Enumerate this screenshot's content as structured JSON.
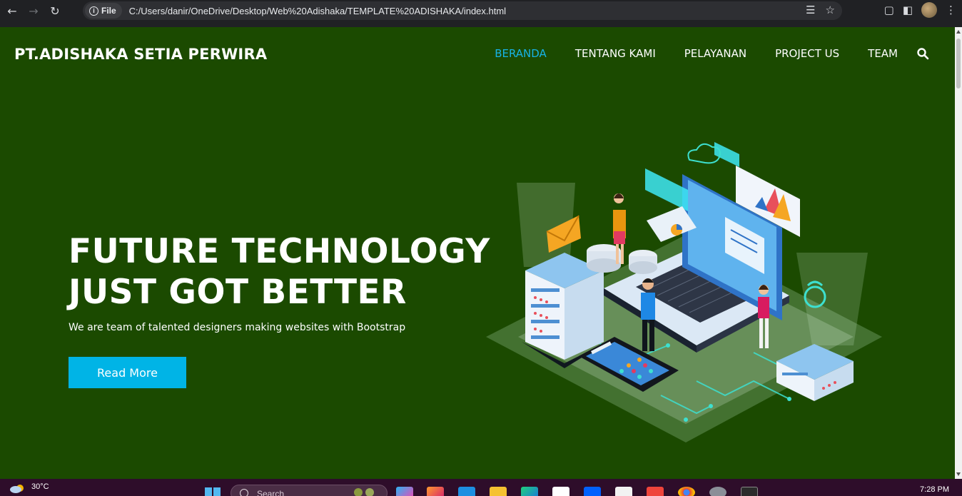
{
  "browser": {
    "file_chip_label": "File",
    "url": "C:/Users/danir/OneDrive/Desktop/Web%20Adishaka/TEMPLATE%20ADISHAKA/index.html",
    "icons": [
      "back-icon",
      "forward-icon",
      "reload-icon",
      "info-icon",
      "translate-icon",
      "bookmark-star-icon",
      "extensions-icon",
      "sidebar-icon",
      "profile-avatar",
      "menu-kebab-icon"
    ]
  },
  "site": {
    "brand": "PT.ADISHAKA SETIA PERWIRA",
    "menu": [
      {
        "label": "BERANDA",
        "active": true
      },
      {
        "label": "TENTANG KAMI",
        "active": false
      },
      {
        "label": "PELAYANAN",
        "active": false
      },
      {
        "label": "PROJECT US",
        "active": false
      },
      {
        "label": "TEAM",
        "active": false
      }
    ],
    "search_icon": "search-icon"
  },
  "hero": {
    "title_line1": "FUTURE TECHNOLOGY",
    "title_line2": "JUST GOT BETTER",
    "subtitle": "We are team of talented designers making websites with Bootstrap",
    "cta_label": "Read More"
  },
  "colors": {
    "page_bg": "#1b4a00",
    "accent": "#17b3e6",
    "button": "#00b4e6",
    "taskbar": "#2e0d2a"
  },
  "taskbar": {
    "temperature": "30°C",
    "search_label": "Search",
    "time": "7:28 PM",
    "apps": [
      "start-icon",
      "copilot-icon",
      "firefox-icon",
      "vscode-icon",
      "file-explorer-icon",
      "edge-icon",
      "store-icon",
      "dropbox-icon",
      "amazon-icon",
      "anydesk-icon",
      "chrome-icon",
      "settings-icon",
      "terminal-icon"
    ]
  }
}
